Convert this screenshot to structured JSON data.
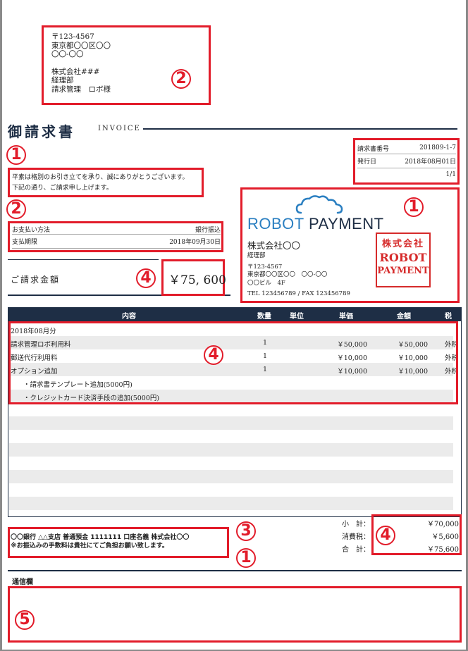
{
  "recipient": {
    "postal": "〒123-4567",
    "address1": "東京都〇〇区〇〇",
    "address2": "〇〇-〇〇",
    "company": "株式会社###",
    "dept": "経理部",
    "person": "請求管理　ロボ様"
  },
  "title": {
    "main": "御請求書",
    "sub": "INVOICE"
  },
  "greeting": {
    "line1": "平素は格別のお引き立てを承り、誠にありがとうございます。",
    "line2": "下記の通り、ご請求申し上げます。"
  },
  "meta": {
    "invoice_no_label": "請求書番号",
    "invoice_no": "201809-1-7",
    "issue_label": "発行日",
    "issue_date": "2018年08月01日",
    "page": "1/1"
  },
  "payment": {
    "method_label": "お支払い方法",
    "method": "銀行振込",
    "due_label": "支払期限",
    "due": "2018年09月30日"
  },
  "amount": {
    "label": "ご請求金額",
    "value": "￥75, 600"
  },
  "issuer": {
    "logo_left": "ROBOT",
    "logo_right": "PAYMENT",
    "company": "株式会社〇〇",
    "dept": "経理部",
    "postal": "〒123-4567",
    "address1": "東京都〇〇区〇〇　〇〇-〇〇",
    "address2": "〇〇ビル　4F",
    "contact": "TEL 123456789 / FAX 123456789",
    "stamp_top": "株式会社",
    "stamp_mid": "ROBOT",
    "stamp_bot": "PAYMENT"
  },
  "table": {
    "headers": {
      "desc": "内容",
      "qty": "数量",
      "unit": "単位",
      "price": "単価",
      "amount": "金額",
      "tax": "税"
    },
    "rows": [
      {
        "desc": "2018年08月分",
        "qty": "",
        "price": "",
        "amount": "",
        "tax": ""
      },
      {
        "desc": "請求管理ロボ利用料",
        "qty": "1",
        "price": "￥50,000",
        "amount": "￥50,000",
        "tax": "外税"
      },
      {
        "desc": "郵送代行利用料",
        "qty": "1",
        "price": "￥10,000",
        "amount": "￥10,000",
        "tax": "外税"
      },
      {
        "desc": "オプション追加",
        "qty": "1",
        "price": "￥10,000",
        "amount": "￥10,000",
        "tax": "外税"
      },
      {
        "desc": "・請求書テンプレート追加(5000円)",
        "qty": "",
        "price": "",
        "amount": "",
        "tax": ""
      },
      {
        "desc": "・クレジットカード決済手段の追加(5000円)",
        "qty": "",
        "price": "",
        "amount": "",
        "tax": ""
      }
    ]
  },
  "bank": {
    "line1": "〇〇銀行 △△支店 普通預金 1111111 口座名義 株式会社〇〇",
    "line2": "※お振込みの手数料は貴社にてご負担お願い致します。"
  },
  "totals": {
    "subtotal_label": "小　計：",
    "subtotal": "￥70,000",
    "tax_label": "消費税：",
    "tax": "￥5,600",
    "total_label": "合　計：",
    "total": "￥75,600"
  },
  "notes": {
    "label": "通信欄"
  },
  "markers": {
    "m1": "1",
    "m2": "2",
    "m3": "3",
    "m4": "4",
    "m5": "5"
  },
  "colors": {
    "accent": "#e21c2a",
    "navy": "#1e2e45",
    "logo_blue": "#2a7fc1"
  }
}
